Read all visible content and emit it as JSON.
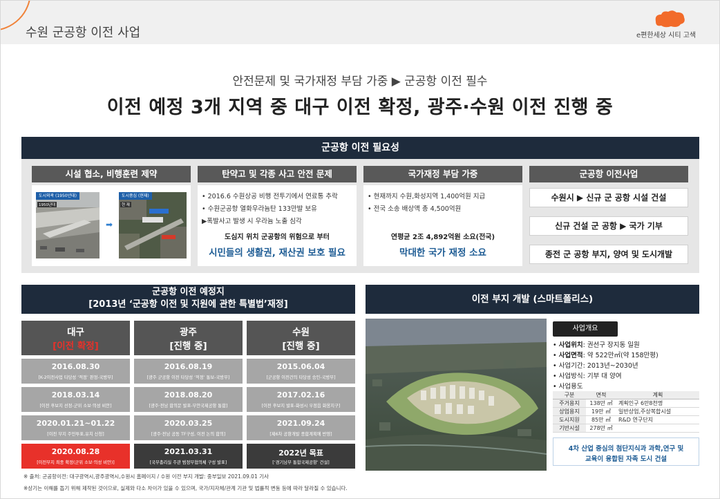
{
  "header": {
    "title": "수원 군공항 이전 사업",
    "brand": "e편한세상 시티 고색"
  },
  "subtitle": "안전문제 및 국가재정 부담 가중 ▶ 군공항 이전 필수",
  "headline": "이전 예정 3개 지역 중 대구 이전 확정, 광주·수원 이전 진행 중",
  "necessity": {
    "title": "군공항 이전 필요성",
    "col1": {
      "title": "시설 협소, 비행훈련 제약",
      "photo1_label": "도시외곽 (1950년대)",
      "photo1_inset": "1950년대",
      "photo2_label": "도시중심 (현재)",
      "photo2_inset": "현 재"
    },
    "col2": {
      "title": "탄약고 및 각종 사고 안전 문제",
      "bullets": [
        "• 2016.6 수원상공 비행 전투기에서 연료통 추락",
        "• 수원군공항 열화우라늄탄 133만발 보유",
        "▶폭발사고 발생 시 우라늄 노출 심각"
      ],
      "emph": "도심지 위치 군공항의 위험으로 부터",
      "blue": "시민들의 생활권, 재산권 보호 필요"
    },
    "col3": {
      "title": "국가재정 부담 가중",
      "bullets": [
        "• 현재까지 수원,화성지역 1,400억원 지급",
        "• 전국 소송 배상액 총 4,500억원"
      ],
      "emph": "연평균 2조 4,892억원 소요(전국)",
      "blue": "막대한 국가 재정 소요"
    },
    "col4": {
      "title": "군공항 이전사업",
      "items": [
        "수원시 ▶ 신규 군 공항 시설 건설",
        "신규 건설 군 공항 ▶ 국가 기부",
        "종전 군 공항 부지, 양여 및 도시개발"
      ]
    }
  },
  "schedule": {
    "title1": "군공항 이전 예정지",
    "title2": "[2013년 ‘군공항 이전 및 지원에 관한 특별법’재정]",
    "cities": [
      {
        "name": "대구",
        "status": "[이전 확정]",
        "status_color": "#e8312a"
      },
      {
        "name": "광주",
        "status": "[진행 중]",
        "status_color": "#ffffff"
      },
      {
        "name": "수원",
        "status": "[진행 중]",
        "status_color": "#ffffff"
      }
    ],
    "daegu": [
      {
        "date": "2016.08.30",
        "event": "[K-2이전사업 타당성 ‘적정’ 판정-국방부]"
      },
      {
        "date": "2018.03.14",
        "event": "[이전 후보지 선정-군위 소보·의성 비안]"
      },
      {
        "date": "2020.01.21~01.22",
        "event": "[이전 부지 주민투표,유치 신청]"
      },
      {
        "date": "2020.08.28",
        "event": "[이전부지 최종 확정(군위 소보·의성 비안)]"
      }
    ],
    "gwangju": [
      {
        "date": "2016.08.19",
        "event": "[광주 군공항 이전 타당성 ‘적정’ 통보-국방부]"
      },
      {
        "date": "2018.08.20",
        "event": "[광주·전남 합의문 발표-무안국제공항 통합]"
      },
      {
        "date": "2020.03.25",
        "event": "[광주·전남 공동 TF구성, 이전 논의 합의]"
      },
      {
        "date": "2021.03.31",
        "event": "[국무총리실 주관 범정부협의체 구성 발표]"
      }
    ],
    "suwon": [
      {
        "date": "2015.06.04",
        "event": "[군공항 이전건의 타당성 승인-국방부]"
      },
      {
        "date": "2017.02.16",
        "event": "[이전 후보지 발표-화성시 우정읍 화옹지구]"
      },
      {
        "date": "2021.09.24",
        "event": "[제6차 공항개발 종합계획에 반영]"
      },
      {
        "date": "2022년 목표",
        "event": "[‘경기남부 통합국제공항’ 건설]"
      }
    ]
  },
  "development": {
    "title": "이전 부지 개발 (스마트폴리스)",
    "overview_label": "사업개요",
    "items": [
      {
        "key": "사업위치",
        "value": ": 권선구 장지동 일원"
      },
      {
        "key": "사업면적",
        "value": ": 약 522만㎡(약 158만평)"
      },
      {
        "key": "사업기간",
        "value": ": 2013년~2030년"
      },
      {
        "key": "사업방식",
        "value": ": 기부 대 양여"
      },
      {
        "key": "사업용도",
        "value": ""
      }
    ],
    "table_headers": [
      "구분",
      "면적",
      "계획"
    ],
    "table_rows": [
      [
        "주거용지",
        "138만 ㎡",
        "계획인구 6만8천명"
      ],
      [
        "상업용지",
        "19만 ㎡",
        "일반상업,주상복합시설"
      ],
      [
        "도시지원",
        "85만 ㎡",
        "R&D 연구단지"
      ],
      [
        "기반시설",
        "278만 ㎡",
        ""
      ]
    ],
    "note1": "4차 산업 중심의 첨단지식과 과학,연구 및",
    "note2": "교육이 융합된 자족 도시 건설"
  },
  "sources": [
    "※ 출처: 군공항이전: 대구광역시,광주광역시,수원시 홈페이지 / 수원 이전 부지 개발: 중부일보 2021.09.01 기사",
    "※상기는 이해를 돕기 위해 제작된 것이므로, 실제와 다소 차이가 있을 수 있으며, 국가/지자체/관계 기관 및 법률적 변동 등에 따라 달라질 수 있습니다."
  ]
}
